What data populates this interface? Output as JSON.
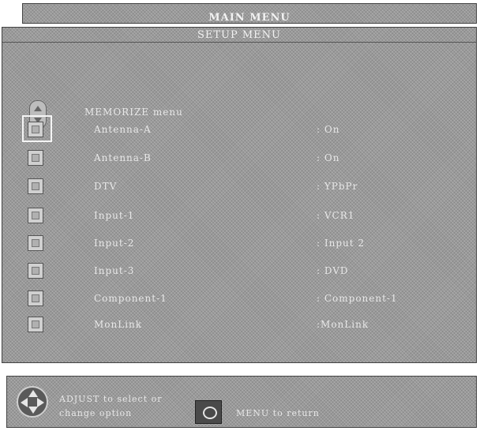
{
  "main_menu": {
    "title": "MAIN MENU"
  },
  "setup_menu": {
    "title": "SETUP MENU",
    "memorize": {
      "label": "MEMORIZE menu",
      "icon": "up-down-arrows-icon"
    },
    "items": [
      {
        "label": "Antenna-A",
        "value": ": On",
        "selected": true
      },
      {
        "label": "Antenna-B",
        "value": ": On",
        "selected": false
      },
      {
        "label": "DTV",
        "value": ": YPbPr",
        "selected": false
      },
      {
        "label": "Input-1",
        "value": ": VCR1",
        "selected": false
      },
      {
        "label": "Input-2",
        "value": ": Input 2",
        "selected": false
      },
      {
        "label": "Input-3",
        "value": ": DVD",
        "selected": false
      },
      {
        "label": "Component-1",
        "value": ": Component-1",
        "selected": false
      },
      {
        "label": "MonLink",
        "value": ":MonLink",
        "selected": false
      }
    ]
  },
  "footer": {
    "adjust_text": "ADJUST to select or change option",
    "dpad_icon": "dpad-icon",
    "menu_key_icon": "menu-key-icon",
    "menu_text": "MENU to return"
  }
}
